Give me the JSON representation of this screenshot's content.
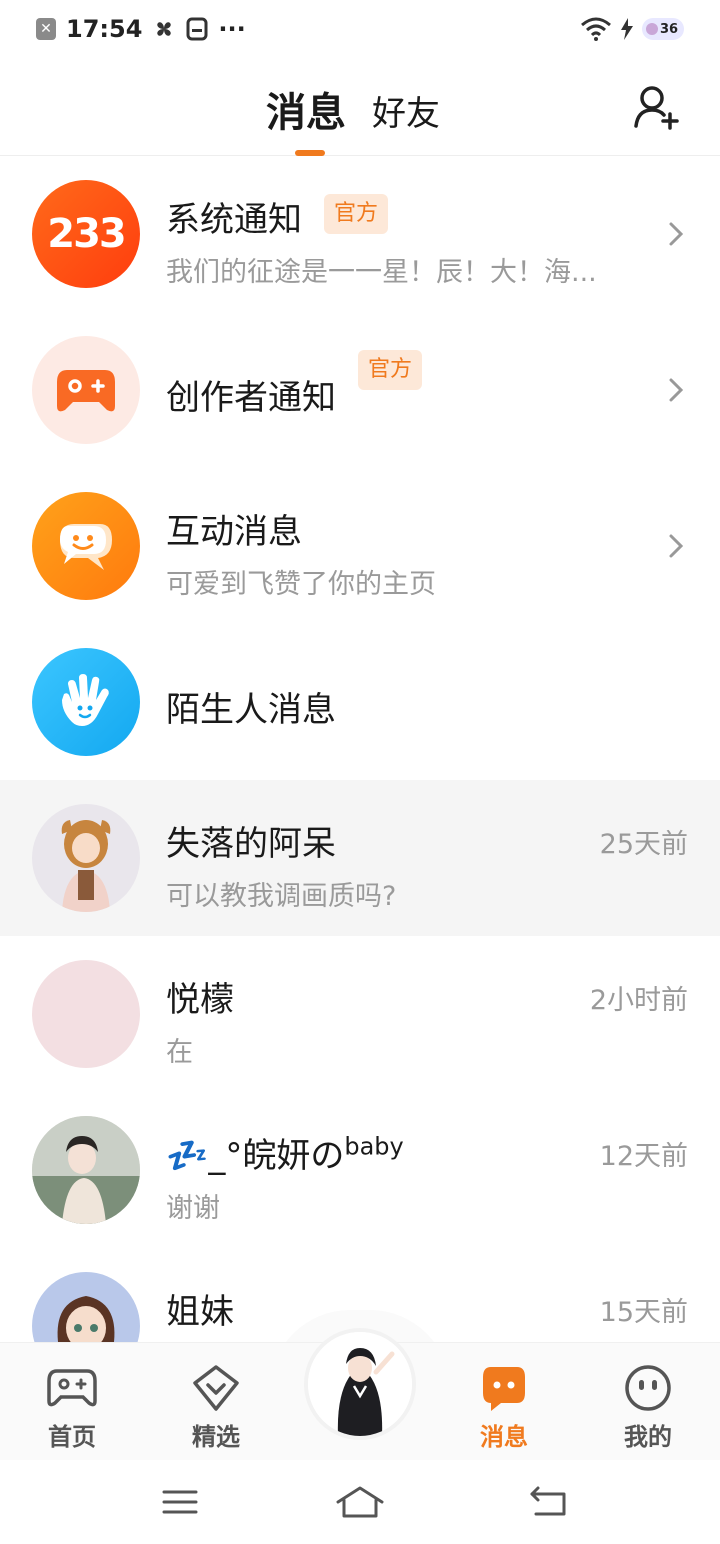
{
  "status": {
    "time": "17:54",
    "dots": "···",
    "battery": "36"
  },
  "header": {
    "tab_active": "消息",
    "tab_other": "好友"
  },
  "rows": [
    {
      "title": "系统通知",
      "tag": "官方",
      "sub": "我们的征途是一一星！辰！大！海...",
      "avatar_text": "233"
    },
    {
      "title": "创作者通知",
      "tag": "官方"
    },
    {
      "title": "互动消息",
      "sub": "可爱到飞赞了你的主页"
    },
    {
      "title": "陌生人消息"
    },
    {
      "title": "失落的阿呆",
      "sub": "可以教我调画质吗?",
      "time": "25天前"
    },
    {
      "title": "悦檬",
      "sub": "在",
      "time": "2小时前"
    },
    {
      "title_emoji": "💤",
      "title": "_°皖妍の",
      "title_sup": "baby",
      "sub": "谢谢",
      "time": "12天前"
    },
    {
      "title": "姐妹",
      "time": "15天前"
    }
  ],
  "nav": {
    "home": "首页",
    "featured": "精选",
    "messages": "消息",
    "mine": "我的"
  },
  "colors": {
    "accent": "#f07a1e",
    "tag_bg": "#fde8d8",
    "muted_text": "#9a9a9a"
  }
}
